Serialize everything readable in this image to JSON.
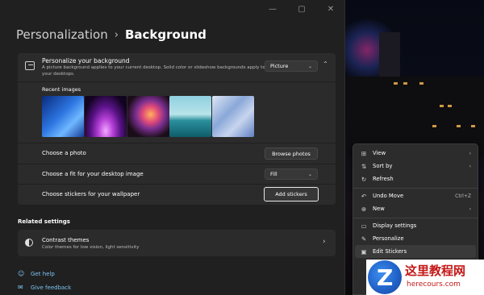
{
  "window": {
    "controls": [
      "—",
      "▢",
      "✕"
    ]
  },
  "breadcrumb": {
    "parent": "Personalization",
    "separator": "›",
    "current": "Background"
  },
  "personalize_background": {
    "title": "Personalize your background",
    "description": "A picture background applies to your current desktop. Solid color or slideshow backgrounds apply to all your desktops.",
    "type_value": "Picture",
    "recent_images_label": "Recent images",
    "choose_photo_label": "Choose a photo",
    "browse_button": "Browse photos",
    "fit_label": "Choose a fit for your desktop image",
    "fit_value": "Fill",
    "stickers_label": "Choose stickers for your wallpaper",
    "add_stickers_button": "Add stickers"
  },
  "related_settings": {
    "heading": "Related settings",
    "contrast_title": "Contrast themes",
    "contrast_subtitle": "Color themes for low vision, light sensitivity"
  },
  "footer_links": {
    "help": "Get help",
    "feedback": "Give feedback"
  },
  "context_menu": {
    "items": [
      {
        "label": "View",
        "icon": "grid-icon",
        "glyph": "⊞",
        "right": "›"
      },
      {
        "label": "Sort by",
        "icon": "sort-icon",
        "glyph": "⇅",
        "right": "›"
      },
      {
        "label": "Refresh",
        "icon": "refresh-icon",
        "glyph": "↻",
        "right": ""
      },
      {
        "label": "Undo Move",
        "icon": "undo-icon",
        "glyph": "↶",
        "right": "Ctrl+Z"
      },
      {
        "label": "New",
        "icon": "new-icon",
        "glyph": "⊕",
        "right": "›"
      },
      {
        "label": "Display settings",
        "icon": "display-icon",
        "glyph": "▭",
        "right": ""
      },
      {
        "label": "Personalize",
        "icon": "brush-icon",
        "glyph": "✎",
        "right": ""
      },
      {
        "label": "Edit Stickers",
        "icon": "sticker-icon",
        "glyph": "▣",
        "right": ""
      }
    ]
  },
  "watermark": {
    "title": "这里教程网",
    "url": "herecours.com"
  }
}
